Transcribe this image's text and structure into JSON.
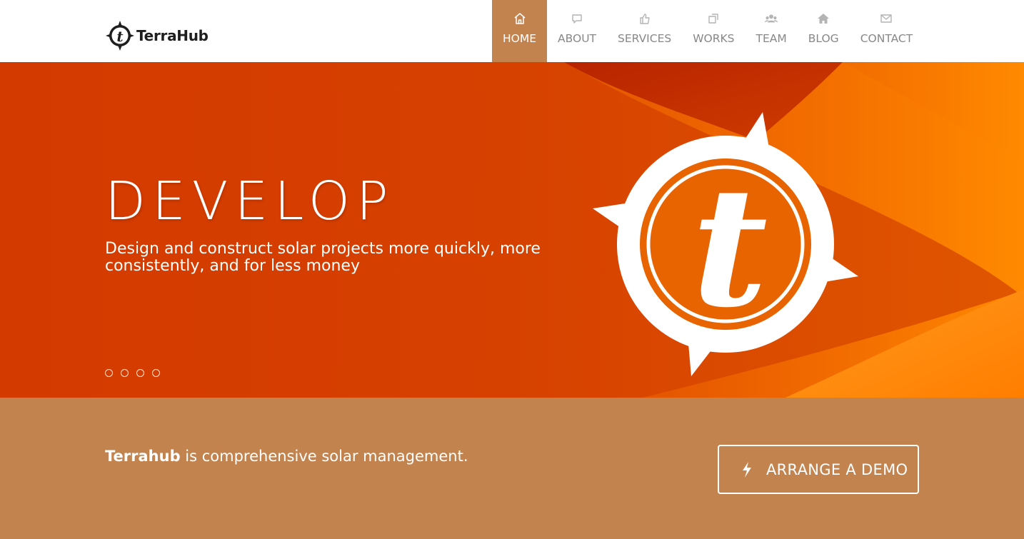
{
  "brand": {
    "name": "TerraHub",
    "logo_letter": "t"
  },
  "nav": {
    "items": [
      {
        "label": "HOME",
        "icon": "home-icon",
        "active": true
      },
      {
        "label": "ABOUT",
        "icon": "speech-bubble-icon",
        "active": false
      },
      {
        "label": "SERVICES",
        "icon": "thumbs-up-icon",
        "active": false
      },
      {
        "label": "WORKS",
        "icon": "copy-icon",
        "active": false
      },
      {
        "label": "TEAM",
        "icon": "group-icon",
        "active": false
      },
      {
        "label": "BLOG",
        "icon": "house-solid-icon",
        "active": false
      },
      {
        "label": "CONTACT",
        "icon": "envelope-icon",
        "active": false
      }
    ]
  },
  "hero": {
    "title": "DEVELOP",
    "subtitle": "Design and construct solar projects more quickly, more consistently, and for less money",
    "emblem_letter": "t",
    "slides": 4,
    "active_slide": 0
  },
  "cta": {
    "brand_bold": "Terrahub",
    "tagline": " is comprehensive solar management.",
    "button_label": "ARRANGE A DEMO",
    "button_icon": "lightning-bolt-icon"
  },
  "colors": {
    "header_bg": "#ffffff",
    "accent": "#c2834f",
    "hero_red": "#d23d00",
    "hero_orange": "#ff8a00",
    "nav_text": "#888888",
    "white": "#ffffff"
  }
}
